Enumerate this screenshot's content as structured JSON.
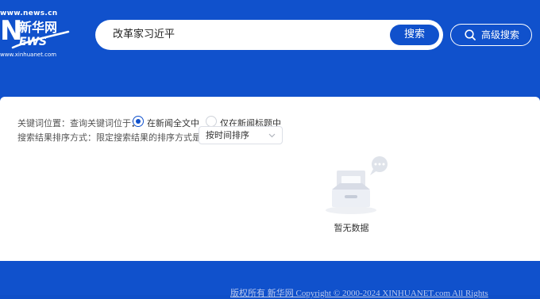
{
  "logo": {
    "url_text": "www.news.cn",
    "n_letter": "N",
    "cn_name": "新华网",
    "ews_text": "EWS",
    "sub_text": "www.xinhuanet.com"
  },
  "search": {
    "query": "改革家习近平",
    "button_label": "搜索",
    "advanced_label": "高级搜索"
  },
  "filters": {
    "position": {
      "label": "关键词位置：查询关键词位于",
      "colon": "：",
      "options": [
        {
          "label": "在新闻全文中",
          "selected": true
        },
        {
          "label": "仅在新闻标题中",
          "selected": false
        }
      ]
    },
    "sort": {
      "label": "搜索结果排序方式：限定搜索结果的排序方式是",
      "colon": "：",
      "selected": "按时间排序"
    }
  },
  "empty_state": {
    "icon": "empty-inbox-icon",
    "text": "暂无数据"
  },
  "footer": {
    "copyright": "版权所有 新华网 Copyright © 2000-2024 XINHUANET.com All Rights"
  },
  "colors": {
    "brand_blue": "#1051cc",
    "page_bg": "#ffffff"
  }
}
